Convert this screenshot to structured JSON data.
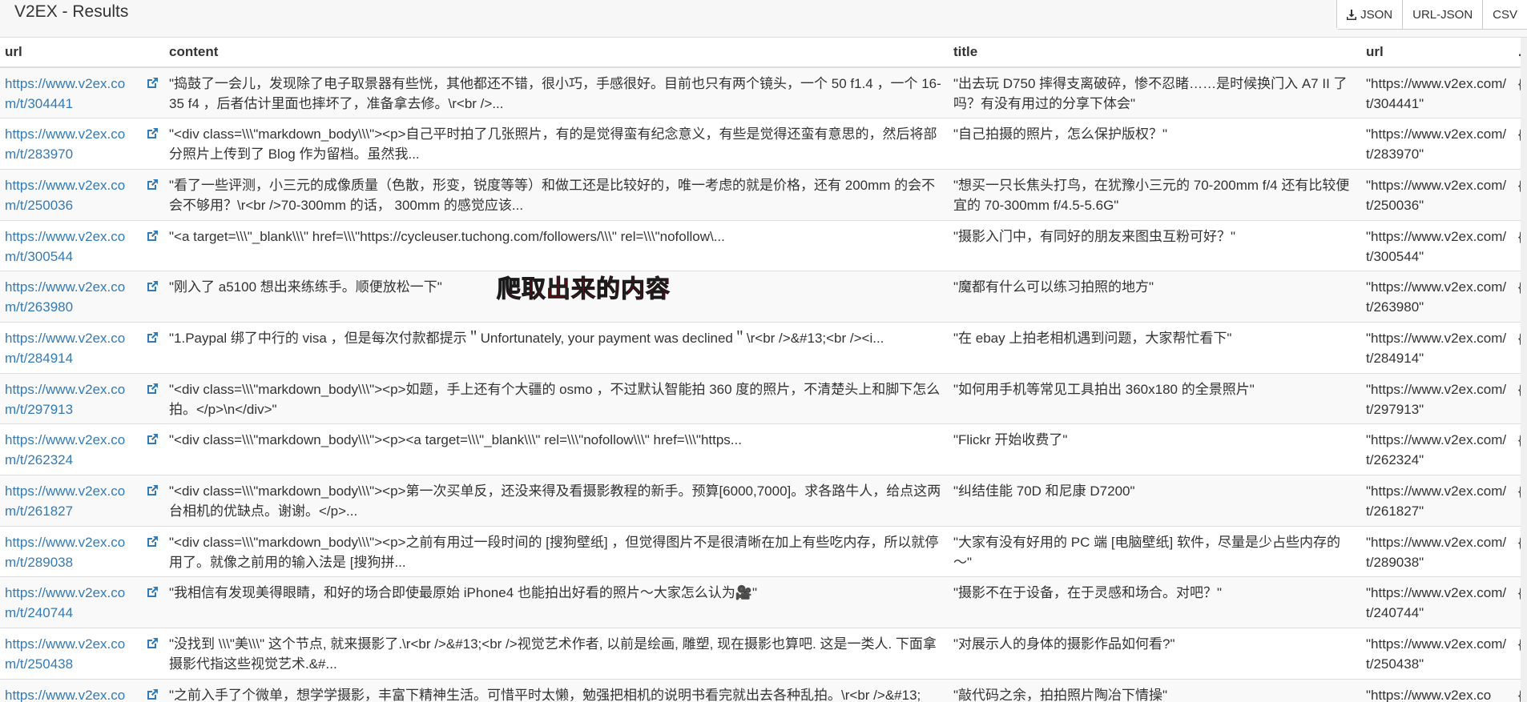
{
  "app": {
    "title": "V2EX - Results"
  },
  "export": {
    "json_label": "JSON",
    "url_json_label": "URL-JSON",
    "csv_label": "CSV"
  },
  "columns": {
    "url": "url",
    "content": "content",
    "title": "title",
    "url2": "url",
    "more": "."
  },
  "annotation": "爬取出来的内容",
  "rows": [
    {
      "url": "https://www.v2ex.com/t/304441",
      "content": "\"捣鼓了一会儿，发现除了电子取景器有些恍，其他都还不错，很小巧，手感很好。目前也只有两个镜头，一个 50 f1.4 ，一个 16-35 f4 ，后者估计里面也摔坏了，准备拿去修。\\r<br />...",
      "title": "\"出去玩 D750 摔得支离破碎，惨不忍睹……是时候换门入 A7 II 了吗？有没有用过的分享下体会\"",
      "url2": "\"https://www.v2ex.com/t/304441\"",
      "more": "{"
    },
    {
      "url": "https://www.v2ex.com/t/283970",
      "content": "\"<div class=\\\\\\\"markdown_body\\\\\\\"><p>自己平时拍了几张照片，有的是觉得蛮有纪念意义，有些是觉得还蛮有意思的，然后将部分照片上传到了 Blog 作为留档。虽然我...",
      "title": "\"自己拍摄的照片，怎么保护版权？\"",
      "url2": "\"https://www.v2ex.com/t/283970\"",
      "more": "{"
    },
    {
      "url": "https://www.v2ex.com/t/250036",
      "content": "\"看了一些评测，小三元的成像质量（色散，形变，锐度等等）和做工还是比较好的，唯一考虑的就是价格，还有 200mm 的会不会不够用？\\r<br />70-300mm 的话， 300mm 的感觉应该...",
      "title": "\"想买一只长焦头打鸟，在犹豫小三元的 70-200mm f/4 还有比较便宜的 70-300mm f/4.5-5.6G\"",
      "url2": "\"https://www.v2ex.com/t/250036\"",
      "more": "{"
    },
    {
      "url": "https://www.v2ex.com/t/300544",
      "content": "\"<a target=\\\\\\\"_blank\\\\\\\" href=\\\\\\\"https://cycleuser.tuchong.com/followers/\\\\\\\" rel=\\\\\\\"nofollow\\...",
      "title": "\"摄影入门中，有同好的朋友来图虫互粉可好？\"",
      "url2": "\"https://www.v2ex.com/t/300544\"",
      "more": "{"
    },
    {
      "url": "https://www.v2ex.com/t/263980",
      "content": "\"刚入了 a5100 想出来练练手。顺便放松一下\"",
      "title": "\"魔都有什么可以练习拍照的地方\"",
      "url2": "\"https://www.v2ex.com/t/263980\"",
      "more": "{"
    },
    {
      "url": "https://www.v2ex.com/t/284914",
      "content": "\"1.Paypal 绑了中行的 visa ，但是每次付款都提示＂Unfortunately, your payment was declined＂\\r<br />&#13;<br /><i...",
      "title": "\"在 ebay 上拍老相机遇到问题，大家帮忙看下\"",
      "url2": "\"https://www.v2ex.com/t/284914\"",
      "more": "{"
    },
    {
      "url": "https://www.v2ex.com/t/297913",
      "content": "\"<div class=\\\\\\\"markdown_body\\\\\\\"><p>如题，手上还有个大疆的 osmo ，不过默认智能拍 360 度的照片，不清楚头上和脚下怎么拍。</p>\\n</div>\"",
      "title": "\"如何用手机等常见工具拍出 360x180 的全景照片\"",
      "url2": "\"https://www.v2ex.com/t/297913\"",
      "more": "{"
    },
    {
      "url": "https://www.v2ex.com/t/262324",
      "content": "\"<div class=\\\\\\\"markdown_body\\\\\\\"><p><a target=\\\\\\\"_blank\\\\\\\" rel=\\\\\\\"nofollow\\\\\\\" href=\\\\\\\"https...",
      "title": "\"Flickr 开始收费了\"",
      "url2": "\"https://www.v2ex.com/t/262324\"",
      "more": "{"
    },
    {
      "url": "https://www.v2ex.com/t/261827",
      "content": "\"<div class=\\\\\\\"markdown_body\\\\\\\"><p>第一次买单反，还没来得及看摄影教程的新手。预算[6000,7000]。求各路牛人，给点这两台相机的优缺点。谢谢。</p>...",
      "title": "\"纠结佳能 70D 和尼康 D7200\"",
      "url2": "\"https://www.v2ex.com/t/261827\"",
      "more": "{"
    },
    {
      "url": "https://www.v2ex.com/t/289038",
      "content": "\"<div class=\\\\\\\"markdown_body\\\\\\\"><p>之前有用过一段时间的 [搜狗壁纸] ，但觉得图片不是很清晰在加上有些吃内存，所以就停用了。就像之前用的输入法是 [搜狗拼...",
      "title": "\"大家有没有好用的 PC 端 [电脑壁纸] 软件，尽量是少占些内存的～\"",
      "url2": "\"https://www.v2ex.com/t/289038\"",
      "more": "{"
    },
    {
      "url": "https://www.v2ex.com/t/240744",
      "content": "\"我相信有发现美得眼睛，和好的场合即使最原始 iPhone4 也能拍出好看的照片～大家怎么认为🎥\"",
      "title": "\"摄影不在于设备，在于灵感和场合。对吧？\"",
      "url2": "\"https://www.v2ex.com/t/240744\"",
      "more": "{"
    },
    {
      "url": "https://www.v2ex.com/t/250438",
      "content": "\"没找到 \\\\\\\"美\\\\\\\" 这个节点, 就来摄影了.\\r<br />&#13;<br />视觉艺术作者, 以前是绘画, 雕塑, 现在摄影也算吧. 这是一类人. 下面拿摄影代指这些视觉艺术.&#...",
      "title": "\"对展示人的身体的摄影作品如何看?\"",
      "url2": "\"https://www.v2ex.com/t/250438\"",
      "more": "{"
    },
    {
      "url": "https://www.v2ex.co",
      "content": "\"之前入手了个微单，想学学摄影，丰富下精神生活。可惜平时太懒，勉强把相机的说明书看完就出去各种乱拍。\\r<br />&#13;",
      "title": "\"敲代码之余，拍拍照片陶冶下情操\"",
      "url2": "\"https://www.v2ex.co",
      "more": "{"
    }
  ]
}
